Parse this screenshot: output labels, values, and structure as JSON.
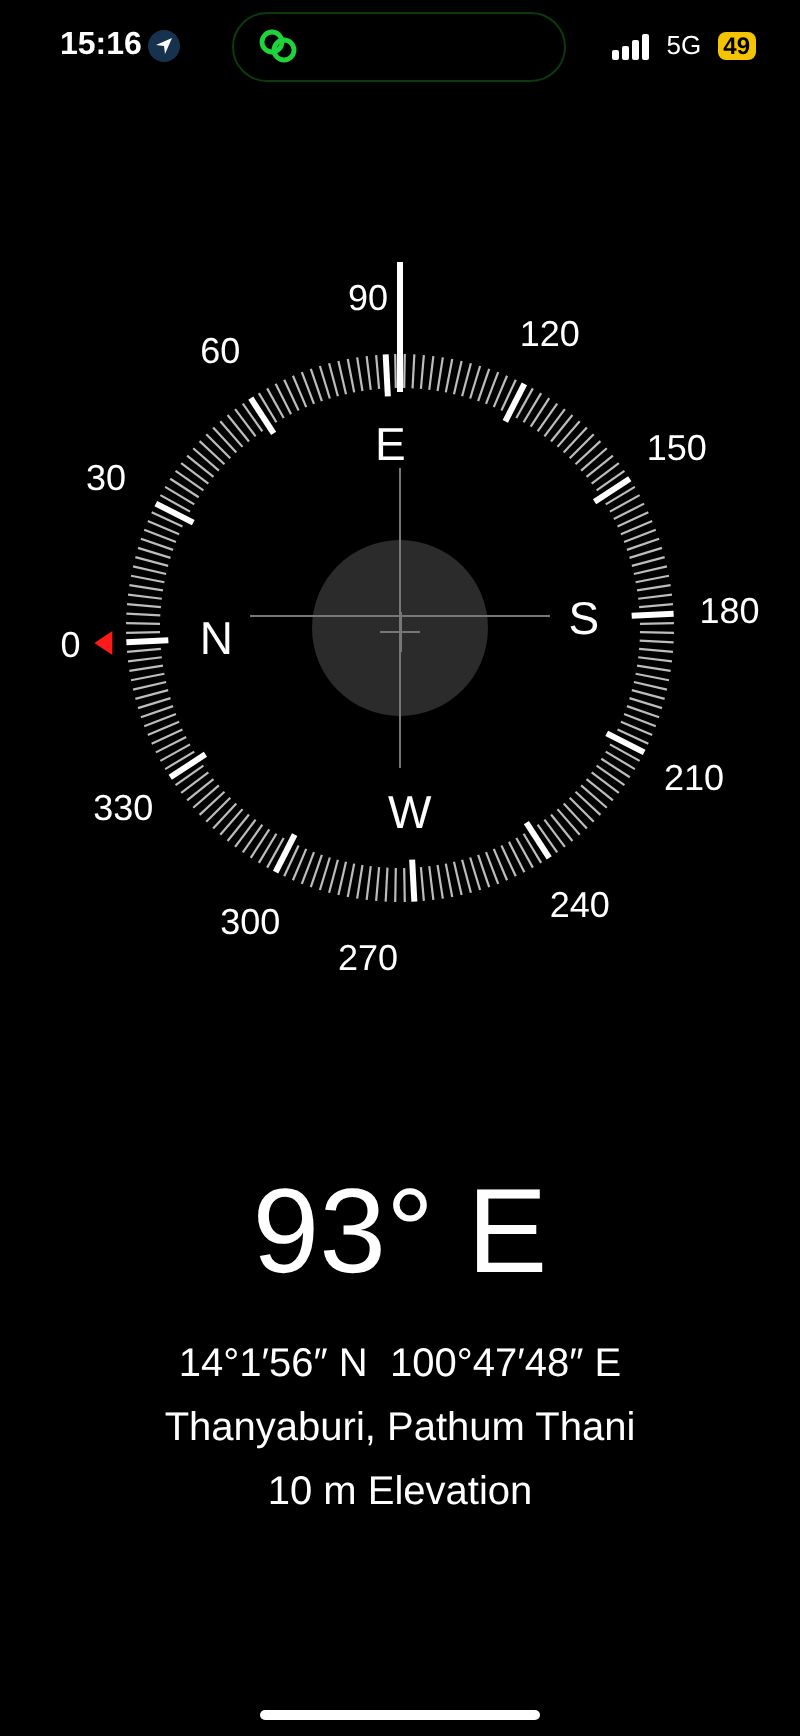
{
  "status_bar": {
    "time": "15:16",
    "network": "5G",
    "battery": "49"
  },
  "compass": {
    "dial_labels": [
      "0",
      "30",
      "60",
      "90",
      "120",
      "150",
      "180",
      "210",
      "240",
      "270",
      "300",
      "330"
    ],
    "cardinals": [
      "N",
      "E",
      "S",
      "W"
    ]
  },
  "reading": {
    "heading": "93° E",
    "coordinates": "14°1′56″ N  100°47′48″ E",
    "place": "Thanyaburi, Pathum Thani",
    "elevation": "10 m Elevation"
  }
}
